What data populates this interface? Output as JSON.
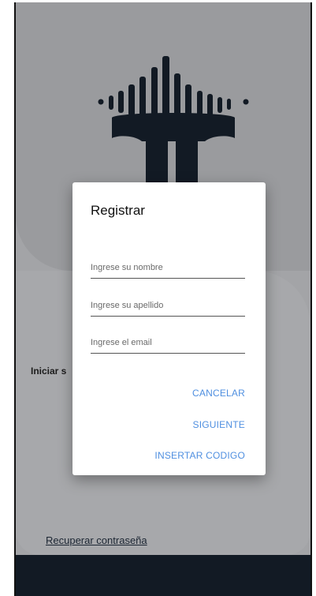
{
  "background": {
    "login_label": "Iniciar s",
    "recover_link": "Recuperar contraseña"
  },
  "dialog": {
    "title": "Registrar",
    "fields": [
      {
        "placeholder": "Ingrese su nombre"
      },
      {
        "placeholder": "Ingrese su apellido"
      },
      {
        "placeholder": "Ingrese el email"
      }
    ],
    "actions": {
      "cancel": "CANCELAR",
      "next": "SIGUIENTE",
      "insert_code": "INSERTAR CODIGO"
    }
  },
  "colors": {
    "accent": "#4f8fe0",
    "logo": "#121a24",
    "scrim": "#a3a4a7"
  },
  "icons": [
    "app-logo-icon"
  ]
}
